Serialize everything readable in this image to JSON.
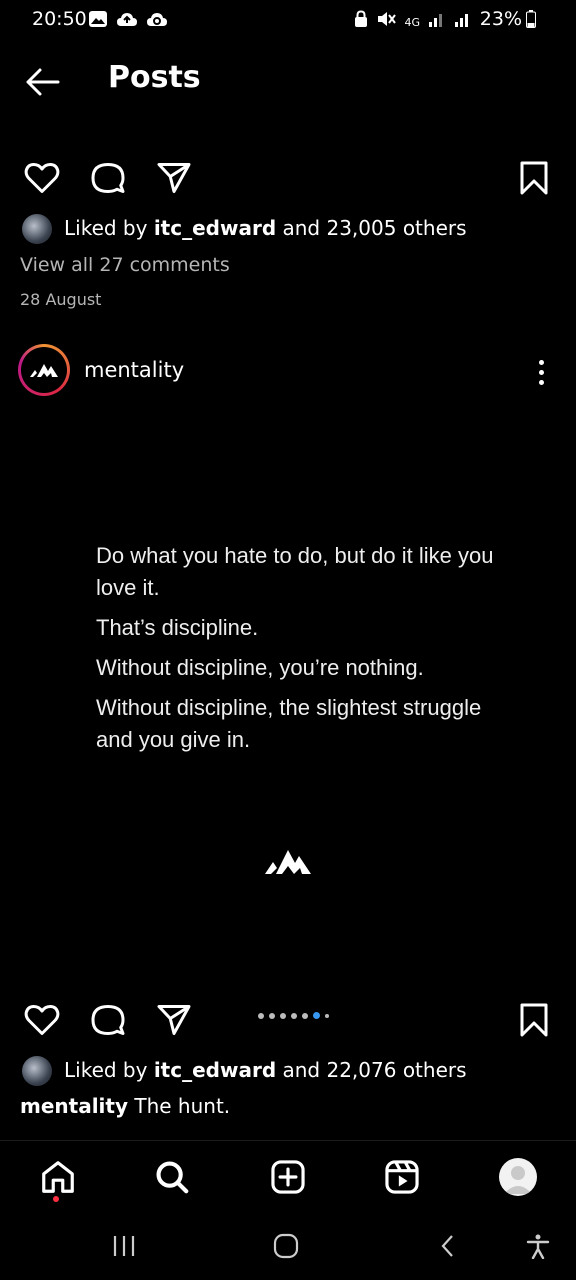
{
  "status_bar": {
    "time": "20:50",
    "network": "4G",
    "battery": "23%"
  },
  "header": {
    "title": "Posts"
  },
  "post1": {
    "liked_by_prefix": "Liked by ",
    "liked_by_user": "itc_edward",
    "liked_by_suffix": " and 23,005 others",
    "view_comments": "View all 27 comments",
    "date": "28 August"
  },
  "post2": {
    "author": "mentality",
    "content_lines": [
      "Do what you hate to do, but do it like you love it.",
      "That’s discipline.",
      "Without discipline, you’re nothing.",
      "Without discipline, the slightest struggle and you give in."
    ],
    "carousel": {
      "total": 7,
      "active_index": 5
    },
    "liked_by_prefix": "Liked by ",
    "liked_by_user": "itc_edward",
    "liked_by_suffix": " and 22,076 others",
    "caption_user": "mentality",
    "caption_text": " The hunt."
  },
  "icons": {
    "back": "arrow-left-icon",
    "like": "heart-icon",
    "comment": "comment-bubble-icon",
    "share": "paper-plane-icon",
    "save": "bookmark-icon",
    "more": "vertical-dots-icon",
    "nav_home": "home-icon",
    "nav_search": "search-icon",
    "nav_create": "plus-square-icon",
    "nav_reels": "reels-icon",
    "nav_profile": "profile-avatar",
    "sys_recents": "recents-icon",
    "sys_home": "home-pill-icon",
    "sys_back": "chevron-left-icon",
    "sys_accessibility": "accessibility-icon"
  },
  "colors": {
    "background": "#000000",
    "active_dot": "#3897f0",
    "notification_dot": "#ff3040"
  }
}
